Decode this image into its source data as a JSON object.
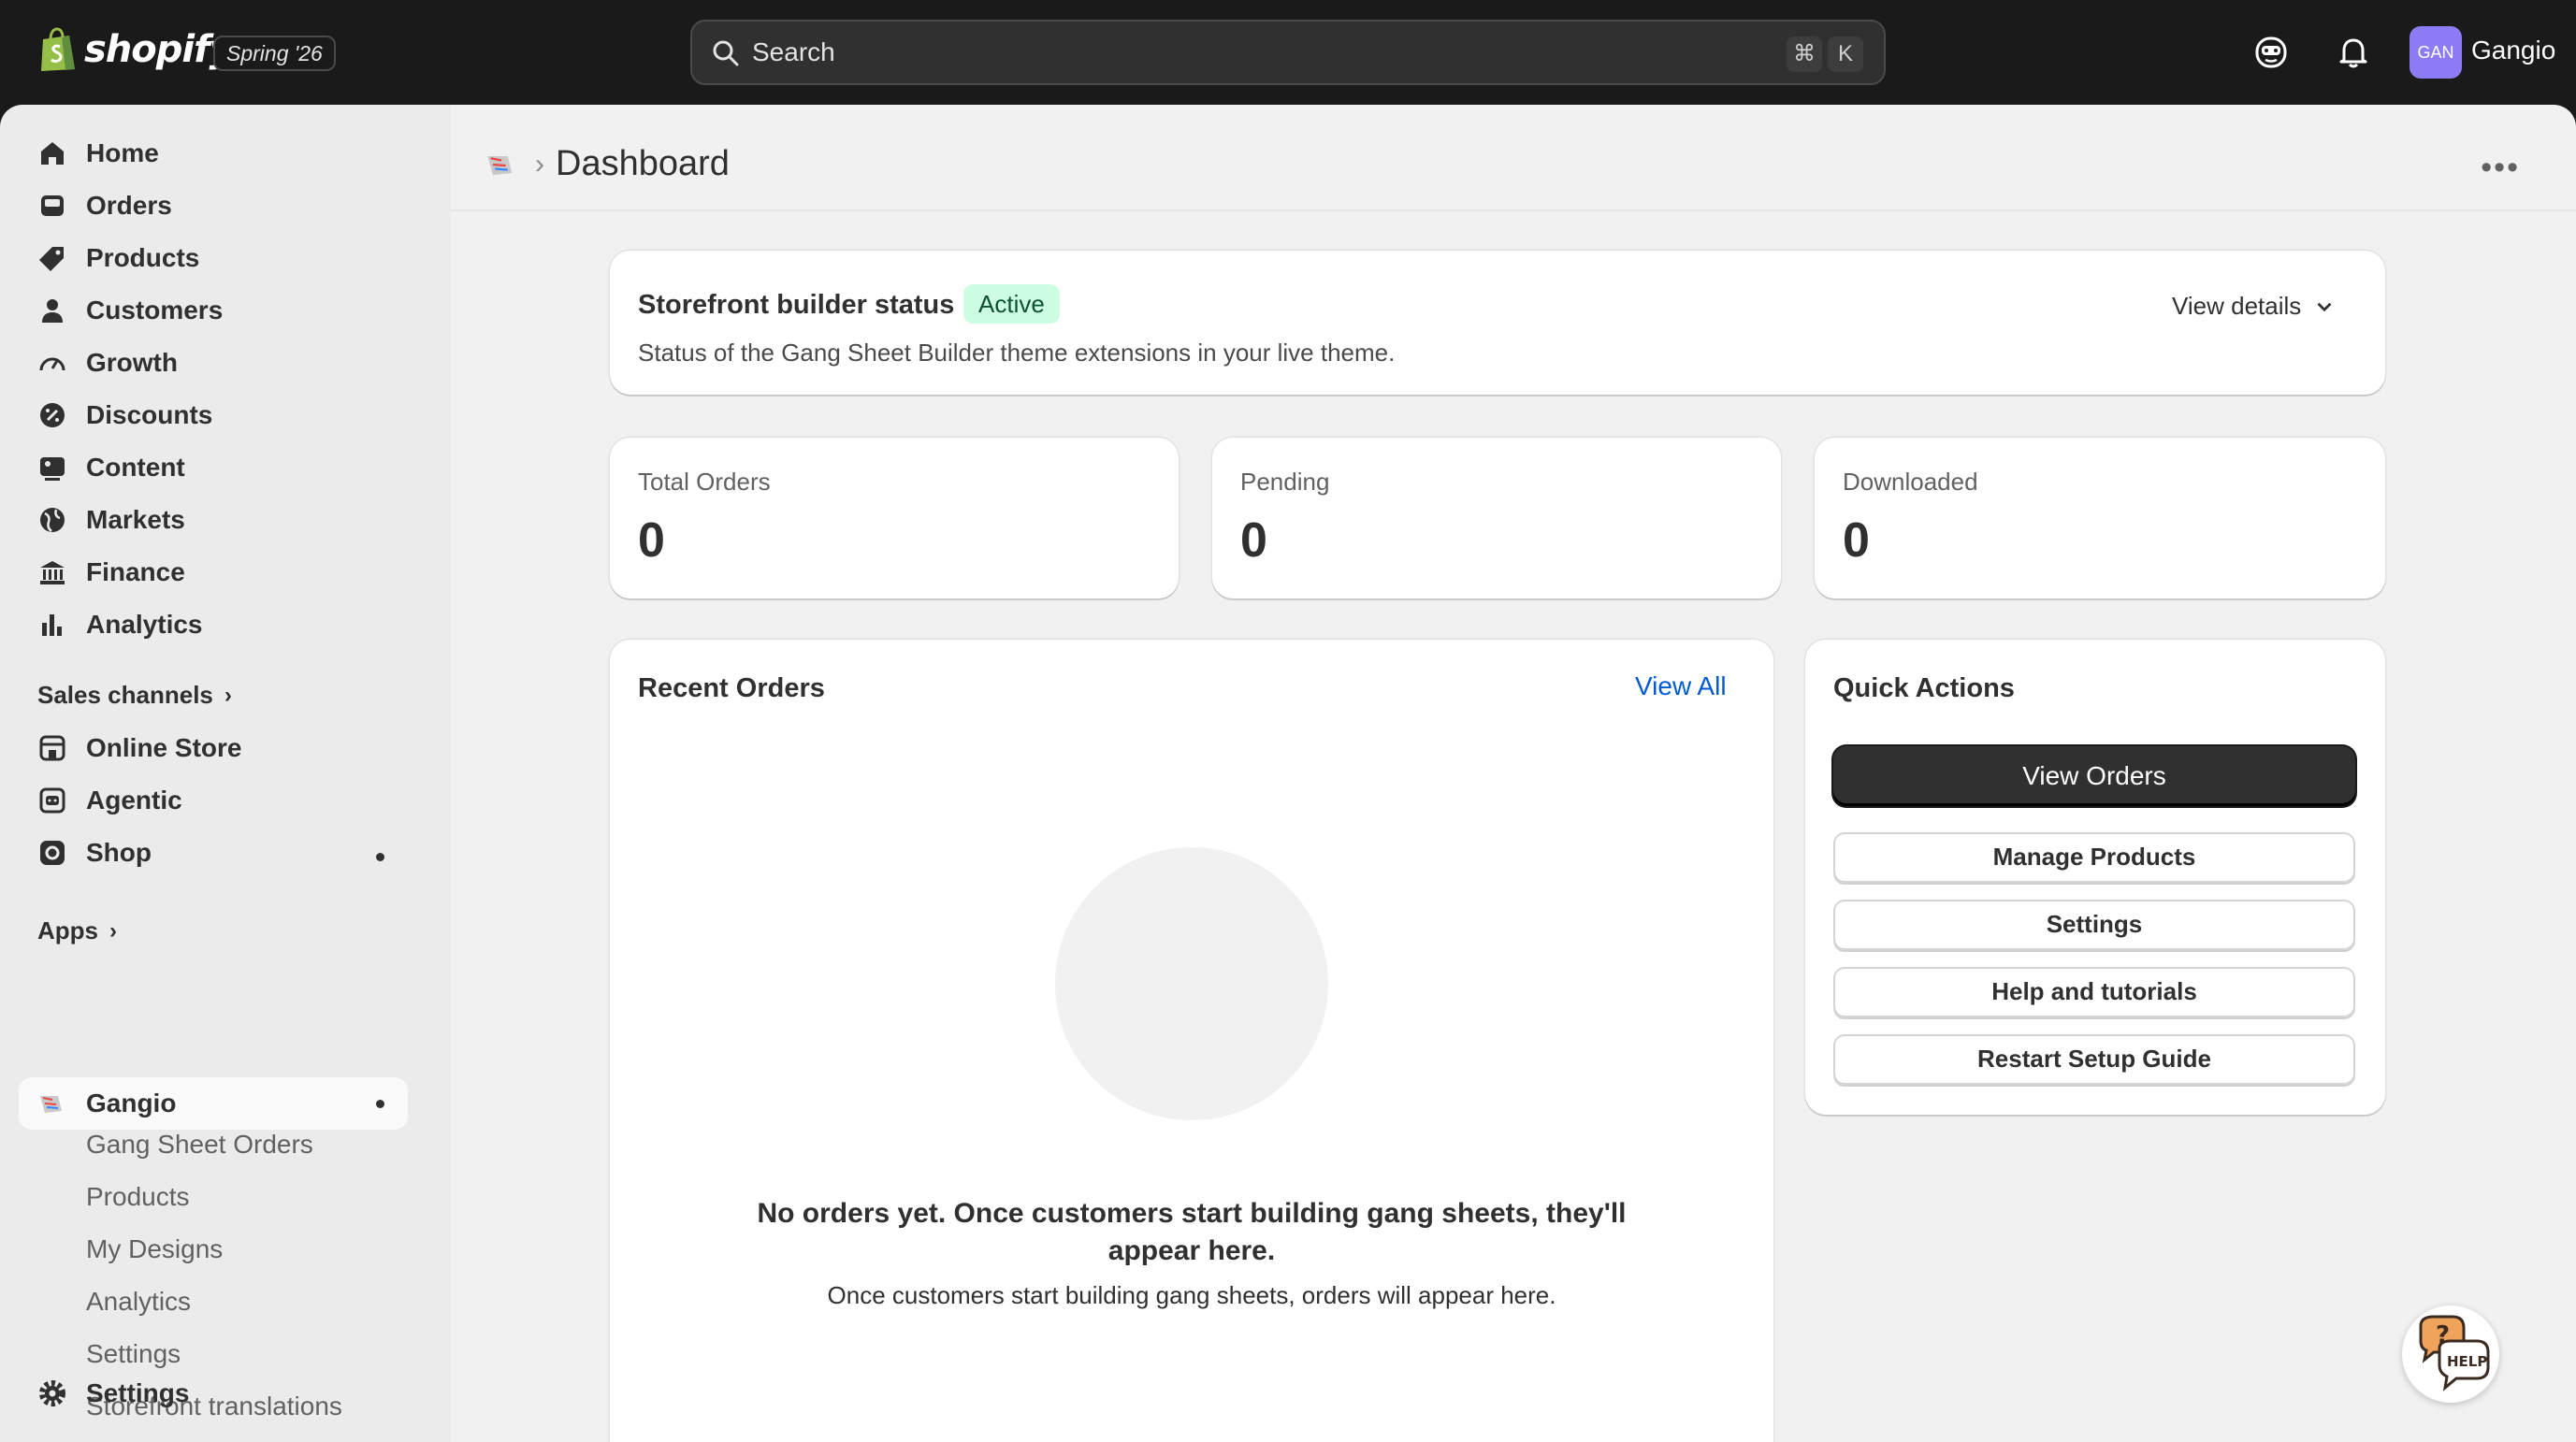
{
  "topbar": {
    "brand": "shopify",
    "edition": "Spring '26",
    "search_placeholder": "Search",
    "shortcut_cmd": "⌘",
    "shortcut_key": "K",
    "avatar_initials": "GAN",
    "store_name": "Gangio"
  },
  "sidebar": {
    "items": [
      {
        "label": "Home",
        "icon": "home-icon"
      },
      {
        "label": "Orders",
        "icon": "inbox-icon"
      },
      {
        "label": "Products",
        "icon": "tag-icon"
      },
      {
        "label": "Customers",
        "icon": "person-icon"
      },
      {
        "label": "Growth",
        "icon": "gauge-icon"
      },
      {
        "label": "Discounts",
        "icon": "discount-icon"
      },
      {
        "label": "Content",
        "icon": "image-icon"
      },
      {
        "label": "Markets",
        "icon": "globe-icon"
      },
      {
        "label": "Finance",
        "icon": "bank-icon"
      },
      {
        "label": "Analytics",
        "icon": "bar-chart-icon"
      }
    ],
    "sales_channels_title": "Sales channels",
    "channels": [
      {
        "label": "Online Store",
        "icon": "store-icon"
      },
      {
        "label": "Agentic",
        "icon": "robot-icon"
      },
      {
        "label": "Shop",
        "icon": "shop-icon"
      }
    ],
    "apps_title": "Apps",
    "app_name": "Gangio",
    "app_subitems": [
      "Gang Sheet Orders",
      "Products",
      "My Designs",
      "Analytics",
      "Settings",
      "Storefront translations"
    ],
    "settings_label": "Settings"
  },
  "main": {
    "page_title": "Dashboard",
    "status_card": {
      "title": "Storefront builder status",
      "badge": "Active",
      "description": "Status of the Gang Sheet Builder theme extensions in your live theme.",
      "view_details": "View details"
    },
    "stats": [
      {
        "label": "Total Orders",
        "value": "0"
      },
      {
        "label": "Pending",
        "value": "0"
      },
      {
        "label": "Downloaded",
        "value": "0"
      }
    ],
    "recent_orders": {
      "title": "Recent Orders",
      "view_all": "View All",
      "empty_heading": "No orders yet. Once customers start building gang sheets, they'll appear here.",
      "empty_body": "Once customers start building gang sheets, orders will appear here."
    },
    "quick_actions": {
      "title": "Quick Actions",
      "primary": "View Orders",
      "buttons": [
        "Manage Products",
        "Settings",
        "Help and tutorials",
        "Restart Setup Guide"
      ]
    }
  },
  "colors": {
    "topbar_bg": "#1a1a1a",
    "sidebar_bg": "#ebebeb",
    "main_bg": "#f1f1f1",
    "badge_bg": "#cdfee1",
    "link": "#005bd3",
    "avatar_bg": "#8b7cf6"
  }
}
